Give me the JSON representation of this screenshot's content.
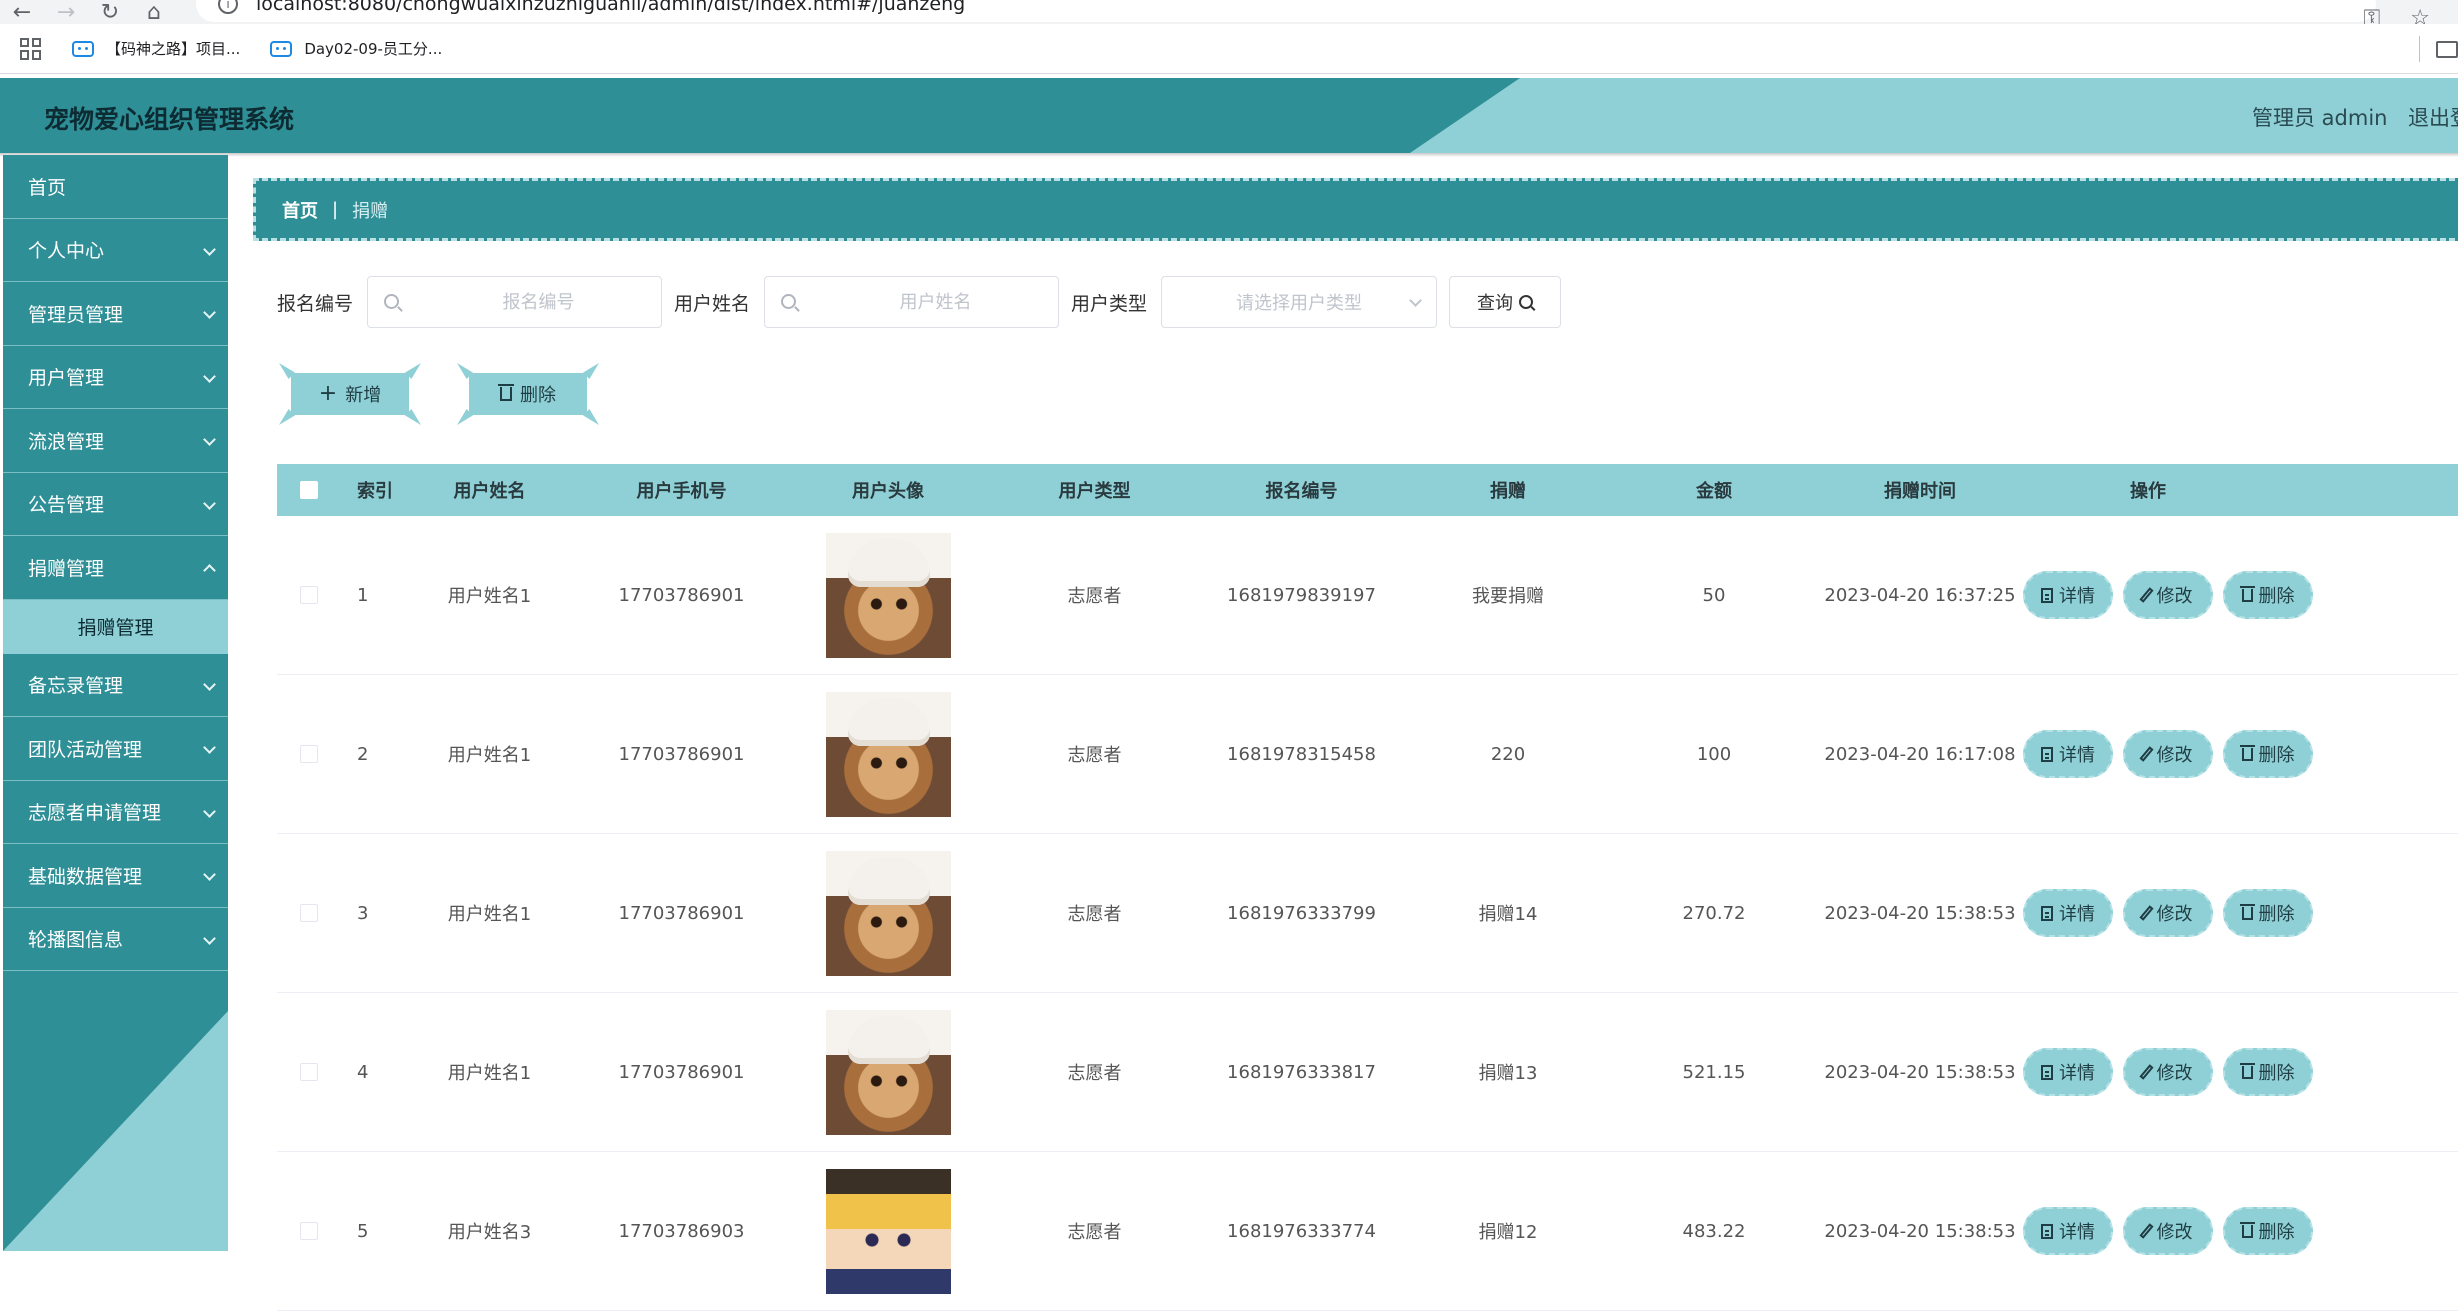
{
  "browser": {
    "url": "localhost:8080/chongwuaixinzuzhiguanli/admin/dist/index.html#/juanzeng",
    "bookmarks": [
      "【码神之路】项目...",
      "Day02-09-员工分..."
    ]
  },
  "header": {
    "title": "宠物爱心组织管理系统",
    "user": "管理员 admin",
    "logout": "退出登录"
  },
  "sidebar": {
    "items": [
      {
        "label": "首页",
        "chevron": false
      },
      {
        "label": "个人中心",
        "chevron": true
      },
      {
        "label": "管理员管理",
        "chevron": true
      },
      {
        "label": "用户管理",
        "chevron": true
      },
      {
        "label": "流浪管理",
        "chevron": true
      },
      {
        "label": "公告管理",
        "chevron": true
      },
      {
        "label": "捐赠管理",
        "chevron": true,
        "open": true
      },
      {
        "label": "备忘录管理",
        "chevron": true
      },
      {
        "label": "团队活动管理",
        "chevron": true
      },
      {
        "label": "志愿者申请管理",
        "chevron": true
      },
      {
        "label": "基础数据管理",
        "chevron": true
      },
      {
        "label": "轮播图信息",
        "chevron": true
      }
    ],
    "submenu": {
      "label": "捐赠管理"
    }
  },
  "breadcrumb": {
    "home": "首页",
    "separator": "|",
    "current": "捐赠"
  },
  "search": {
    "reg_label": "报名编号",
    "reg_placeholder": "报名编号",
    "name_label": "用户姓名",
    "name_placeholder": "用户姓名",
    "type_label": "用户类型",
    "type_placeholder": "请选择用户类型",
    "query_label": "查询"
  },
  "actions": {
    "add_label": "新增",
    "delete_label": "删除"
  },
  "table": {
    "headers": [
      "索引",
      "用户姓名",
      "用户手机号",
      "用户头像",
      "用户类型",
      "报名编号",
      "捐赠",
      "金额",
      "捐赠时间",
      "操作"
    ],
    "rows": [
      {
        "index": "1",
        "name": "用户姓名1",
        "phone": "17703786901",
        "avatar": "cat",
        "type": "志愿者",
        "reg": "1681979839197",
        "donation": "我要捐赠",
        "amount": "50",
        "time": "2023-04-20 16:37:25"
      },
      {
        "index": "2",
        "name": "用户姓名1",
        "phone": "17703786901",
        "avatar": "cat",
        "type": "志愿者",
        "reg": "1681978315458",
        "donation": "220",
        "amount": "100",
        "time": "2023-04-20 16:17:08"
      },
      {
        "index": "3",
        "name": "用户姓名1",
        "phone": "17703786901",
        "avatar": "cat",
        "type": "志愿者",
        "reg": "1681976333799",
        "donation": "捐赠14",
        "amount": "270.72",
        "time": "2023-04-20 15:38:53"
      },
      {
        "index": "4",
        "name": "用户姓名1",
        "phone": "17703786901",
        "avatar": "cat",
        "type": "志愿者",
        "reg": "1681976333817",
        "donation": "捐赠13",
        "amount": "521.15",
        "time": "2023-04-20 15:38:53"
      },
      {
        "index": "5",
        "name": "用户姓名3",
        "phone": "17703786903",
        "avatar": "boy",
        "type": "志愿者",
        "reg": "1681976333774",
        "donation": "捐赠12",
        "amount": "483.22",
        "time": "2023-04-20 15:38:53"
      }
    ],
    "ops": {
      "detail": "详情",
      "edit": "修改",
      "delete": "删除"
    }
  },
  "colors": {
    "primary": "#2f8f96",
    "accent": "#8fd0d6"
  }
}
